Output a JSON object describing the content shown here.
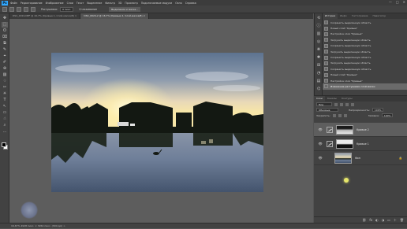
{
  "menubar": {
    "logo": "Ps",
    "items": [
      "Файл",
      "Редактирование",
      "Изображение",
      "Слои",
      "Текст",
      "Выделение",
      "Фильтр",
      "3D",
      "Просмотр",
      "Подключаемые модули",
      "Окно",
      "Справка"
    ],
    "controls": [
      "—",
      "□",
      "✕"
    ]
  },
  "options": {
    "sample_label": "Растушевка:",
    "sample_value": "0 пикс.",
    "smooth_label": "Сглаживание",
    "select_button": "Выделение и маска..."
  },
  "tabs": [
    {
      "label": "DSC_0019.NEF @ 16,7% (Кривые 1, Слой-маска/8) ×",
      "active": false
    },
    {
      "label": "DSC_0024-2 @ 16,7% (Кривые 2, Слой-маска/8) ×",
      "active": true
    }
  ],
  "tools": [
    "✥",
    "⬚",
    "ʘ",
    "⌧",
    "⧉",
    "✎",
    "⌖",
    "✐",
    "⊕",
    "▨",
    "♢",
    "✂",
    "☀",
    "T",
    "↖",
    "▭",
    "☝",
    "⌕",
    "…"
  ],
  "history": {
    "tabs": [
      "История",
      "Инфо",
      "Гистограмма",
      "Навигатор"
    ],
    "items": [
      {
        "label": "Сохранить выделенную область",
        "selected": false
      },
      {
        "label": "Новый слой \"Кривые\"",
        "selected": false
      },
      {
        "label": "Настройка слоя \"Кривые\"",
        "selected": false
      },
      {
        "label": "Загрузить выделенную область",
        "selected": false
      },
      {
        "label": "Сохранить выделенную область",
        "selected": false
      },
      {
        "label": "Загрузить выделенную область",
        "selected": false
      },
      {
        "label": "Сохранить выделенную область",
        "selected": false
      },
      {
        "label": "Загрузить выделенную область",
        "selected": false
      },
      {
        "label": "Сохранить выделенную область",
        "selected": false
      },
      {
        "label": "Новый слой \"Кривые\"",
        "selected": false
      },
      {
        "label": "Настройка слоя \"Кривые\"",
        "selected": false
      },
      {
        "label": "Изменение растушевки слой-маски",
        "selected": true
      }
    ]
  },
  "strip_icons": [
    "⟲",
    "ⓘ",
    "▥",
    "◎",
    "❋",
    "✱",
    "⊞",
    "◔",
    "▤",
    "⌬"
  ],
  "layers": {
    "tabs": [
      "Слои",
      "Каналы",
      "Контуры"
    ],
    "kind_label": "Вид",
    "blend_mode": "Обычные",
    "opacity_label": "Непрозрачность:",
    "opacity_value": "100%",
    "lock_label": "Закрепить:",
    "fill_label": "Заливка:",
    "fill_value": "100%",
    "items": [
      {
        "name": "Кривые 2",
        "type": "adjustment",
        "selected": true
      },
      {
        "name": "Кривые 1",
        "type": "adjustment",
        "selected": false
      },
      {
        "name": "Фон",
        "type": "background",
        "selected": false
      }
    ],
    "footer_icons": [
      "⛓",
      "fx",
      "◐",
      "◑",
      "▭",
      "＋",
      "🗑"
    ]
  },
  "status": {
    "text": "16,67%   4928 пикс. × 3264 пикс. (300 ppi)   >"
  }
}
